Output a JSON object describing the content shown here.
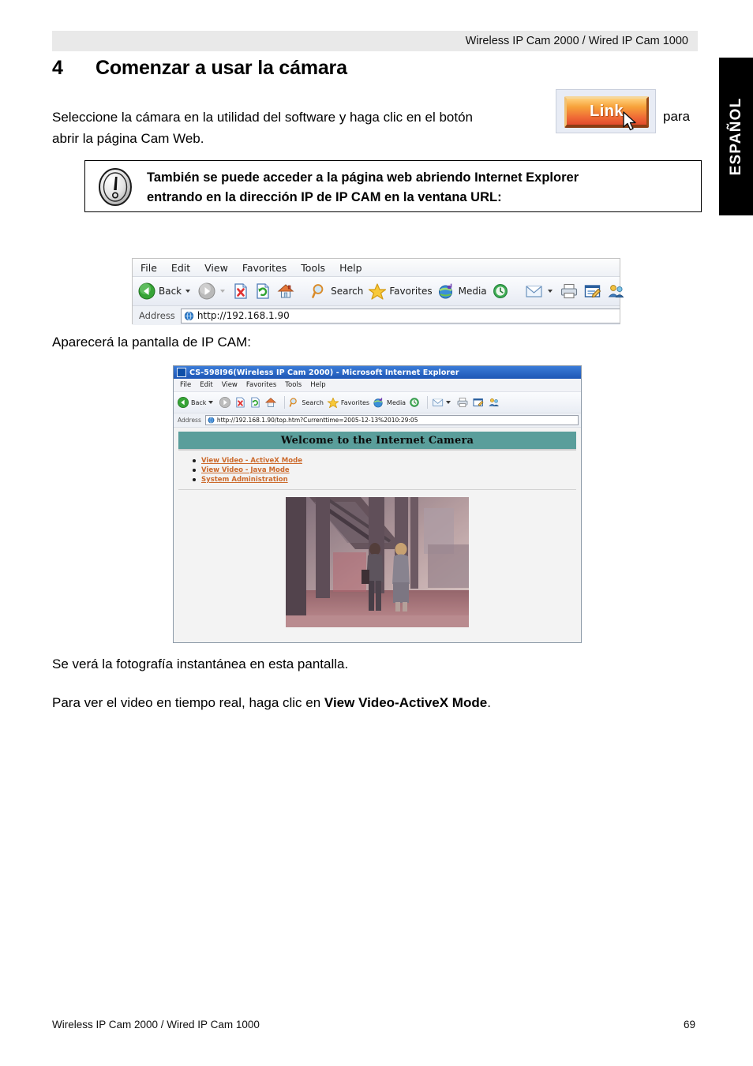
{
  "header": {
    "running_head": "Wireless IP Cam 2000 / Wired IP Cam 1000"
  },
  "language_tab": {
    "label": "ESPAÑOL"
  },
  "section": {
    "number": "4",
    "title": "Comenzar a usar la cámara"
  },
  "intro": {
    "line1": "Seleccione la cámara en la utilidad del software y haga clic en el botón",
    "after_button": "para",
    "line2": "abrir la página Cam Web.",
    "link_button_label": "Link"
  },
  "notice": {
    "line1": "También se puede acceder a la página web abriendo Internet Explorer",
    "line2": "entrando en la dirección IP de IP CAM en la ventana URL:"
  },
  "ie_toolbar_figure": {
    "menu": [
      "File",
      "Edit",
      "View",
      "Favorites",
      "Tools",
      "Help"
    ],
    "buttons": [
      {
        "icon": "back-arrow-icon",
        "label": "Back"
      },
      {
        "icon": "forward-arrow-icon",
        "label": ""
      },
      {
        "icon": "stop-icon",
        "label": ""
      },
      {
        "icon": "refresh-icon",
        "label": ""
      },
      {
        "icon": "home-icon",
        "label": ""
      },
      {
        "icon": "search-icon",
        "label": "Search"
      },
      {
        "icon": "favorites-star-icon",
        "label": "Favorites"
      },
      {
        "icon": "media-globe-icon",
        "label": "Media"
      },
      {
        "icon": "history-clock-icon",
        "label": ""
      },
      {
        "icon": "mail-icon",
        "label": ""
      },
      {
        "icon": "print-icon",
        "label": ""
      },
      {
        "icon": "edit-page-icon",
        "label": ""
      },
      {
        "icon": "messenger-icon",
        "label": ""
      }
    ],
    "address_label": "Address",
    "address_value": "http://192.168.1.90"
  },
  "caption_appear": "Aparecerá la pantalla de IP CAM:",
  "camera_window": {
    "title": "CS-598I96(Wireless IP Cam 2000) - Microsoft Internet Explorer",
    "menu": [
      "File",
      "Edit",
      "View",
      "Favorites",
      "Tools",
      "Help"
    ],
    "buttons": [
      {
        "icon": "back-arrow-icon",
        "label": "Back"
      },
      {
        "icon": "forward-arrow-icon",
        "label": ""
      },
      {
        "icon": "stop-icon",
        "label": ""
      },
      {
        "icon": "refresh-icon",
        "label": ""
      },
      {
        "icon": "home-icon",
        "label": ""
      },
      {
        "icon": "search-icon",
        "label": "Search"
      },
      {
        "icon": "favorites-star-icon",
        "label": "Favorites"
      },
      {
        "icon": "media-globe-icon",
        "label": "Media"
      },
      {
        "icon": "history-clock-icon",
        "label": ""
      },
      {
        "icon": "mail-icon",
        "label": ""
      },
      {
        "icon": "print-icon",
        "label": ""
      },
      {
        "icon": "edit-page-icon",
        "label": ""
      },
      {
        "icon": "messenger-icon",
        "label": ""
      }
    ],
    "address_label": "Address",
    "address_value": "http://192.168.1.90/top.htm?Currenttime=2005-12-13%2010:29:05",
    "banner": "Welcome to the Internet Camera",
    "links": [
      "View Video - ActiveX Mode",
      "View Video - Java Mode",
      "System Administration"
    ],
    "banner_color": "#5a9e9b",
    "link_color": "#cc6a2c"
  },
  "trailing": {
    "snapshot": "Se verá la fotografía instantánea en esta pantalla.",
    "realtime_pre": "Para ver el video en tiempo real, haga clic en ",
    "realtime_bold": "View Video-ActiveX Mode",
    "realtime_post": "."
  },
  "footer": {
    "left": "Wireless IP Cam 2000 / Wired IP Cam 1000",
    "page_number": "69"
  }
}
